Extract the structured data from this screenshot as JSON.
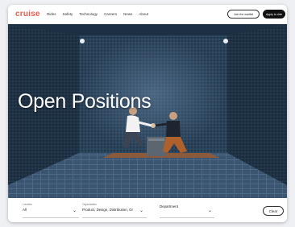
{
  "brand": {
    "logo": "cruise",
    "accent": "#f05a4e"
  },
  "nav": {
    "links": [
      "Rides",
      "Safety",
      "Technology",
      "Careers",
      "News",
      "About"
    ],
    "cta_secondary": "Join the waitlist",
    "cta_primary": "Apply to ride"
  },
  "hero": {
    "title": "Open Positions"
  },
  "filters": {
    "location": {
      "label": "Location",
      "value": "All"
    },
    "organization": {
      "label": "Organization",
      "value": "Product, Design, Distribution, Gr"
    },
    "department": {
      "label": "",
      "value": "Department"
    },
    "clear_label": "Clear"
  }
}
